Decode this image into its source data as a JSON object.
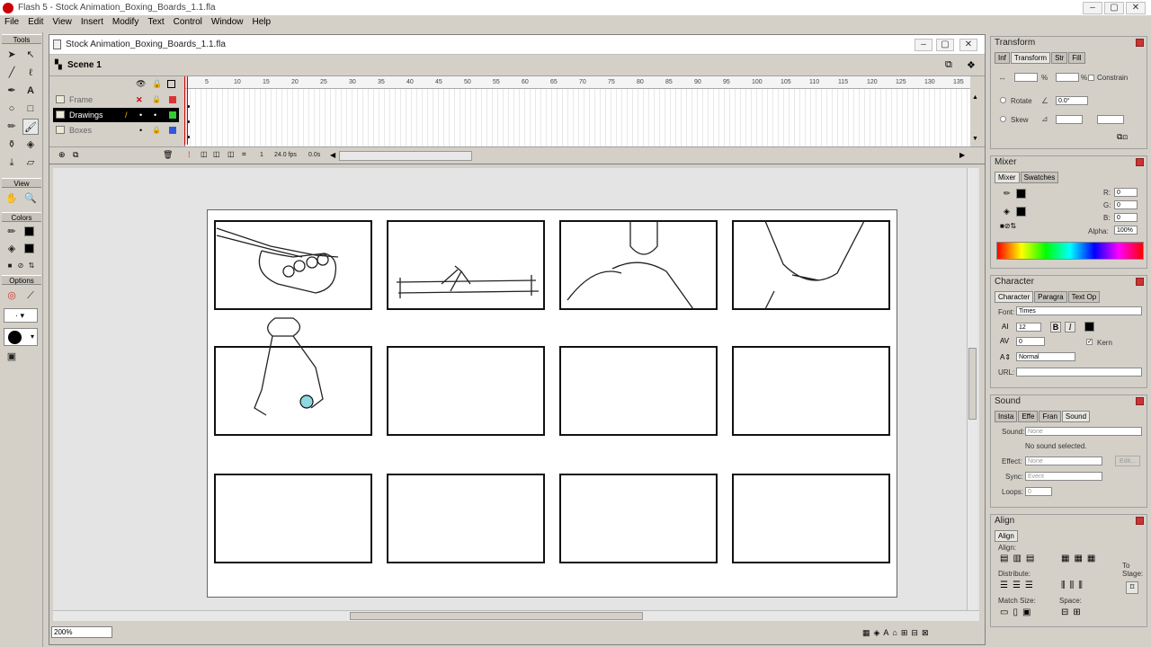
{
  "app": {
    "title": "Flash 5 - Stock Animation_Boxing_Boards_1.1.fla",
    "window_controls": [
      "–",
      "▢",
      "✕"
    ]
  },
  "menu": [
    "File",
    "Edit",
    "View",
    "Insert",
    "Modify",
    "Text",
    "Control",
    "Window",
    "Help"
  ],
  "toolbox": {
    "sections": {
      "tools": "Tools",
      "view": "View",
      "colors": "Colors",
      "options": "Options"
    }
  },
  "document": {
    "title": "Stock Animation_Boxing_Boards_1.1.fla",
    "scene": "Scene 1",
    "layers": [
      {
        "name": "Frame",
        "color": "#dd3333"
      },
      {
        "name": "Drawings",
        "color": "#33cc33"
      },
      {
        "name": "Boxes",
        "color": "#3355dd"
      }
    ],
    "ruler": [
      "5",
      "10",
      "15",
      "20",
      "25",
      "30",
      "35",
      "40",
      "45",
      "50",
      "55",
      "60",
      "65",
      "70",
      "75",
      "80",
      "85",
      "90",
      "95",
      "100",
      "105",
      "110",
      "115",
      "120",
      "125",
      "130",
      "135"
    ],
    "current_frame": "1",
    "fps": "24.0 fps",
    "elapsed": "0.0s",
    "zoom": "200%"
  },
  "panels": {
    "transform": {
      "title": "Transform",
      "tabs": [
        "Inf",
        "Transform",
        "Str",
        "Fill"
      ],
      "constrain": "Constrain",
      "rotate": "Rotate",
      "skew": "Skew",
      "angle": "0.0°",
      "pct1": "%",
      "pct2": "%"
    },
    "mixer": {
      "title": "Mixer",
      "tabs": [
        "Mixer",
        "Swatches"
      ],
      "r_label": "R:",
      "r": "0",
      "g_label": "G:",
      "g": "0",
      "b_label": "B:",
      "b": "0",
      "alpha_label": "Alpha:",
      "alpha": "100%"
    },
    "character": {
      "title": "Character",
      "tabs": [
        "Character",
        "Paragra",
        "Text Op"
      ],
      "font_label": "Font:",
      "font": "Times",
      "size": "12",
      "bold": "B",
      "italic": "I",
      "tracking": "0",
      "kern": "Kern",
      "baseline": "Normal",
      "url_label": "URL:"
    },
    "sound": {
      "title": "Sound",
      "tabs": [
        "Insta",
        "Effe",
        "Fran",
        "Sound"
      ],
      "sound_label": "Sound:",
      "sound": "None",
      "status": "No sound selected.",
      "effect_label": "Effect:",
      "effect": "None",
      "edit": "Edit...",
      "sync_label": "Sync:",
      "sync": "Event",
      "loops_label": "Loops:",
      "loops": "0"
    },
    "align": {
      "title": "Align",
      "tabs": [
        "Align"
      ],
      "align_label": "Align:",
      "distribute_label": "Distribute:",
      "match_label": "Match Size:",
      "space_label": "Space:",
      "stage_label": "To Stage:"
    }
  }
}
